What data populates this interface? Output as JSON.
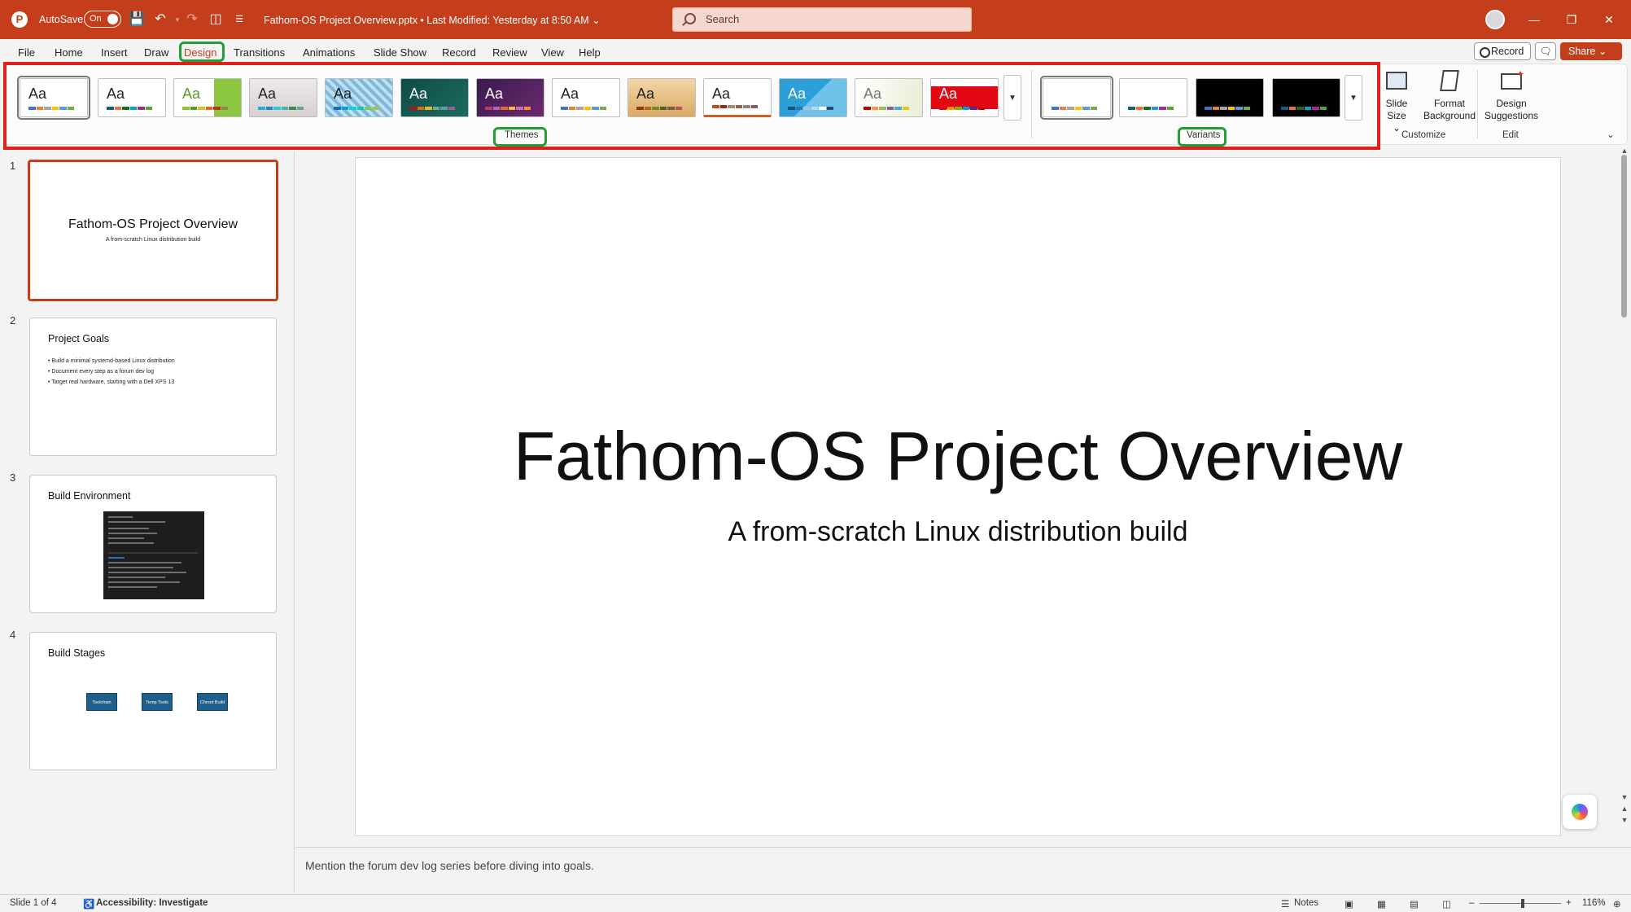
{
  "titlebar": {
    "autosave_label": "AutoSave",
    "autosave_state": "On",
    "file_title": "Fathom-OS Project Overview.pptx • Last Modified: Yesterday at 8:50 AM ⌄",
    "search_placeholder": "Search"
  },
  "menu": {
    "tabs": [
      "File",
      "Home",
      "Insert",
      "Draw",
      "Design",
      "Transitions",
      "Animations",
      "Slide Show",
      "Record",
      "Review",
      "View",
      "Help"
    ],
    "active_tab": "Design",
    "record_label": "Record",
    "share_label": "Share ⌄"
  },
  "ribbon": {
    "themes_label": "Themes",
    "variants_label": "Variants",
    "customize_label": "Customize",
    "edit_label": "Edit",
    "slide_size_label": "Slide Size ⌄",
    "format_background_label": "Format Background",
    "design_suggestions_label": "Design Suggestions",
    "theme_sample": "Aa",
    "accent_color": "#c43e1c",
    "highlight_color": "#22a035",
    "region_color": "#e0201b"
  },
  "slides": {
    "numbers": [
      "1",
      "2",
      "3",
      "4"
    ],
    "s1": {
      "title": "Fathom-OS Project Overview",
      "subtitle": "A from-scratch Linux distribution build"
    },
    "s2": {
      "title": "Project Goals",
      "bullets": [
        "• Build a minimal systemd-based Linux distribution",
        "• Document every step as a forum dev log",
        "• Target real hardware, starting with a Dell XPS 13"
      ]
    },
    "s3": {
      "title": "Build Environment"
    },
    "s4": {
      "title": "Build Stages",
      "stages": [
        "Toolchain",
        "Temp Tools",
        "Chroot Build"
      ]
    }
  },
  "current_slide": {
    "title": "Fathom-OS Project Overview",
    "subtitle": "A from-scratch Linux distribution build"
  },
  "notes": "Mention the forum dev log series before diving into goals.",
  "status": {
    "slide_indicator": "Slide 1 of 4",
    "accessibility": "Accessibility: Investigate",
    "notes_label": "Notes",
    "zoom": "116%"
  }
}
